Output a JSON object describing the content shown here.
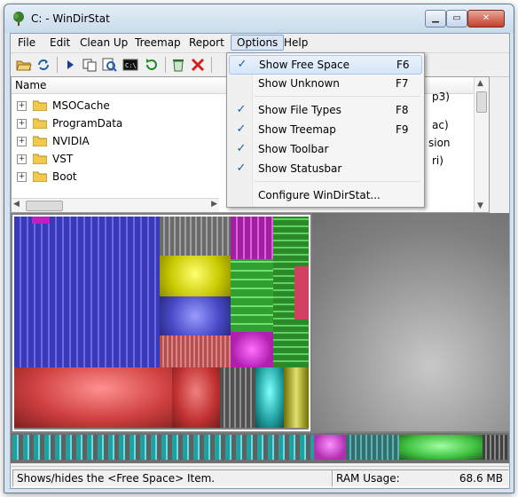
{
  "window": {
    "title": "C: - WinDirStat"
  },
  "menubar": {
    "items": [
      "File",
      "Edit",
      "Clean Up",
      "Treemap",
      "Report",
      "Options",
      "Help"
    ]
  },
  "tree": {
    "header_name": "Name",
    "rows": [
      "MSOCache",
      "ProgramData",
      "NVIDIA",
      "VST",
      "Boot"
    ],
    "right_fragments": [
      "p3)",
      "ac)",
      "sion",
      "ri)"
    ]
  },
  "options_menu": {
    "items": [
      {
        "label": "Show Free Space",
        "shortcut": "F6",
        "checked": true
      },
      {
        "label": "Show Unknown",
        "shortcut": "F7",
        "checked": false
      },
      {
        "label": "Show File Types",
        "shortcut": "F8",
        "checked": true
      },
      {
        "label": "Show Treemap",
        "shortcut": "F9",
        "checked": true
      },
      {
        "label": "Show Toolbar",
        "shortcut": "",
        "checked": true
      },
      {
        "label": "Show Statusbar",
        "shortcut": "",
        "checked": true
      },
      {
        "label": "Configure WinDirStat...",
        "shortcut": "",
        "checked": false
      }
    ],
    "check_glyph": "✓"
  },
  "statusbar": {
    "message": "Shows/hides the <Free Space> Item.",
    "ram_label": "RAM Usage:",
    "ram_value": "68.6 MB"
  },
  "colors": {
    "blue_files": "#4b4bd6",
    "magenta_files": "#c020c0",
    "green_files": "#40c040",
    "red_files": "#d04040",
    "yellow_files": "#d0d000",
    "cyan_files": "#20c0c0",
    "free_space": "#808080"
  },
  "icons": [
    "open-folder-icon",
    "refresh-icon",
    "play-icon",
    "copy-icon",
    "explorer-icon",
    "command-prompt-icon",
    "refresh-selected-icon",
    "recycle-bin-icon",
    "delete-icon"
  ]
}
